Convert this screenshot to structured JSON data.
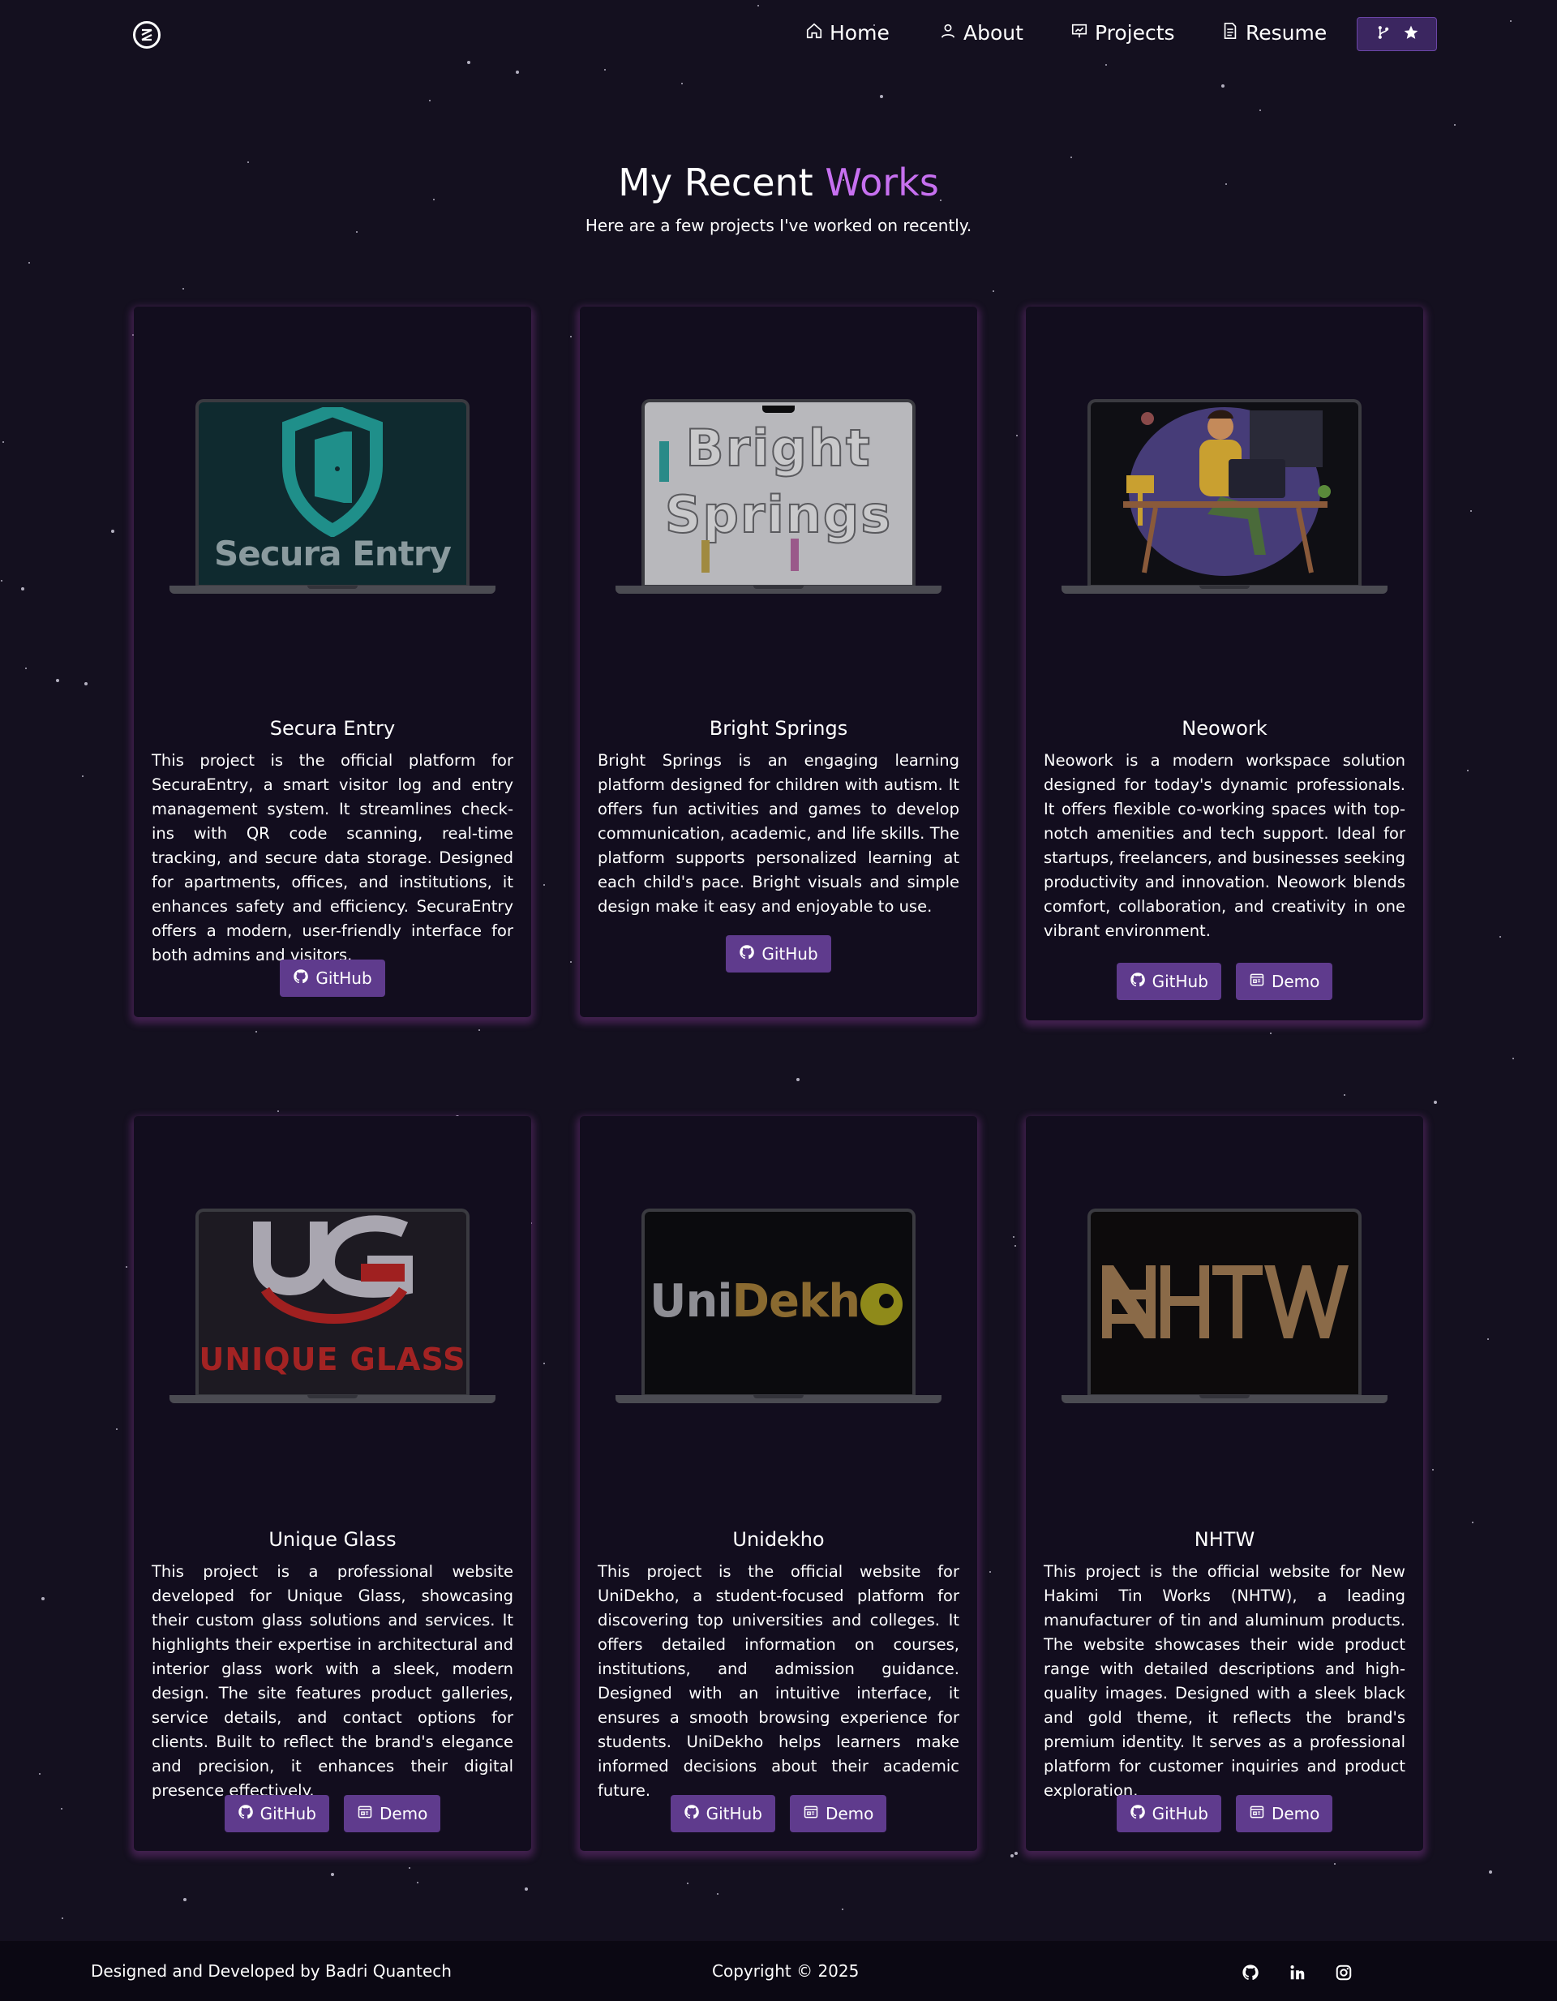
{
  "nav": {
    "home": "Home",
    "about": "About",
    "projects": "Projects",
    "resume": "Resume"
  },
  "header": {
    "title_main": "My Recent",
    "title_accent": "Works",
    "subtitle": "Here are a few projects I've worked on recently."
  },
  "projects": [
    {
      "title": "Secura Entry",
      "screen_text": "Secura Entry",
      "description": "This project is the official platform for SecuraEntry, a smart visitor log and entry management system. It streamlines check-ins with QR code scanning, real-time tracking, and secure data storage. Designed for apartments, offices, and institutions, it enhances safety and efficiency. SecuraEntry offers a modern, user-friendly interface for both admins and visitors.",
      "github_label": "GitHub"
    },
    {
      "title": "Bright Springs",
      "screen_text_1": "Bright",
      "screen_text_2": "Springs",
      "description": "Bright Springs is an engaging learning platform designed for children with autism. It offers fun activities and games to develop communication, academic, and life skills. The platform supports personalized learning at each child's pace. Bright visuals and simple design make it easy and enjoyable to use.",
      "github_label": "GitHub"
    },
    {
      "title": "Neowork",
      "description": "Neowork is a modern workspace solution designed for today's dynamic professionals. It offers flexible co-working spaces with top-notch amenities and tech support. Ideal for startups, freelancers, and businesses seeking productivity and innovation. Neowork blends comfort, collaboration, and creativity in one vibrant environment.",
      "github_label": "GitHub",
      "demo_label": "Demo"
    },
    {
      "title": "Unique Glass",
      "screen_text": "UNIQUE GLASS",
      "description": "This project is a professional website developed for Unique Glass, showcasing their custom glass solutions and services. It highlights their expertise in architectural and interior glass work with a sleek, modern design. The site features product galleries, service details, and contact options for clients. Built to reflect the brand's elegance and precision, it enhances their digital presence effectively.",
      "github_label": "GitHub",
      "demo_label": "Demo"
    },
    {
      "title": "Unidekho",
      "screen_text_a": "Uni",
      "screen_text_b": "Dekh",
      "description": "This project is the official website for UniDekho, a student-focused platform for discovering top universities and colleges. It offers detailed information on courses, institutions, and admission guidance. Designed with an intuitive interface, it ensures a smooth browsing experience for students. UniDekho helps learners make informed decisions about their academic future.",
      "github_label": "GitHub",
      "demo_label": "Demo"
    },
    {
      "title": "NHTW",
      "description": "This project is the official website for New Hakimi Tin Works (NHTW), a leading manufacturer of tin and aluminum products. The website showcases their wide product range with detailed descriptions and high-quality images. Designed with a sleek black and gold theme, it reflects the brand's premium identity. It serves as a professional platform for customer inquiries and product exploration.",
      "github_label": "GitHub",
      "demo_label": "Demo"
    }
  ],
  "footer": {
    "credit": "Designed and Developed by Badri Quantech",
    "copyright": "Copyright © 2025",
    "socials": [
      "github-icon",
      "linkedin-icon",
      "instagram-icon"
    ]
  },
  "colors": {
    "background": "#14101f",
    "accent": "#c770f0",
    "button": "#5f3b8d",
    "card_glow": "#773588"
  }
}
